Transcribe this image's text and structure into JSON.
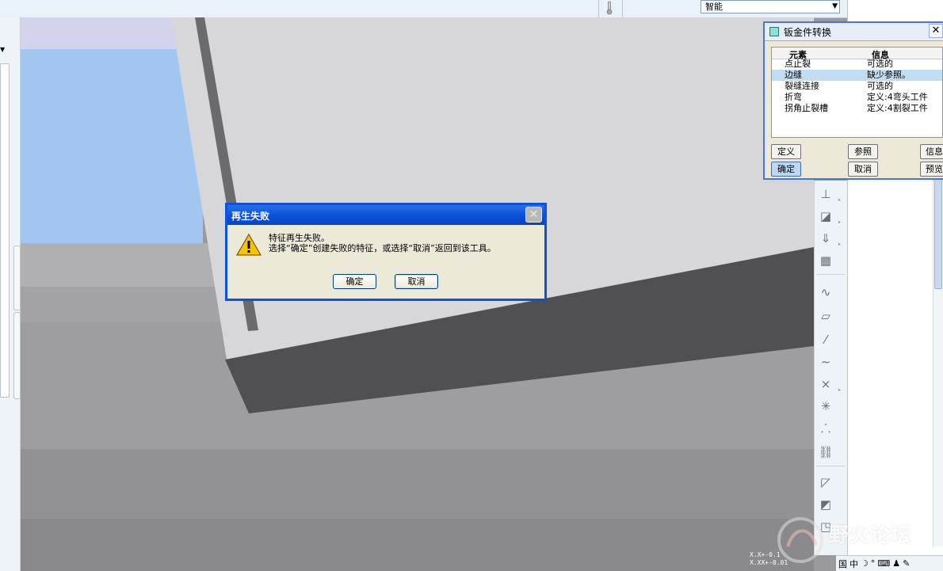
{
  "toolbar": {
    "filter_value": "智能"
  },
  "sheetmetal_dialog": {
    "title": "钣金件转换",
    "columns": [
      "元素",
      "信息"
    ],
    "rows": [
      {
        "element": "点止裂",
        "info": "可选的"
      },
      {
        "element": "边缝",
        "info": "缺少参照。"
      },
      {
        "element": "裂缝连接",
        "info": "可选的"
      },
      {
        "element": "折弯",
        "info": "定义:4弯头工件"
      },
      {
        "element": "拐角止裂槽",
        "info": "定义:4割裂工件"
      }
    ],
    "selected_row": 1,
    "buttons": {
      "define": "定义",
      "reference": "参照",
      "info": "信息",
      "ok": "确定",
      "cancel": "取消",
      "preview": "预览"
    }
  },
  "failure_dialog": {
    "title": "再生失败",
    "message_line1": "特征再生失败。",
    "message_line2": "选择“确定”创建失败的特征，或选择“取消”返回到该工具。",
    "ok_label": "确定",
    "cancel_label": "取消"
  },
  "viewport": {
    "coord_line1": "X.X+-0.1",
    "coord_line2": "X.XX+-0.01"
  },
  "statusbar": {
    "ime_label": "中",
    "flag": "国"
  },
  "watermark": {
    "text": "野火论坛"
  },
  "icons": [
    "thermometer-icon",
    "dropdown-arrow-icon",
    "warning-icon",
    "close-icon",
    "dialog-icon"
  ]
}
